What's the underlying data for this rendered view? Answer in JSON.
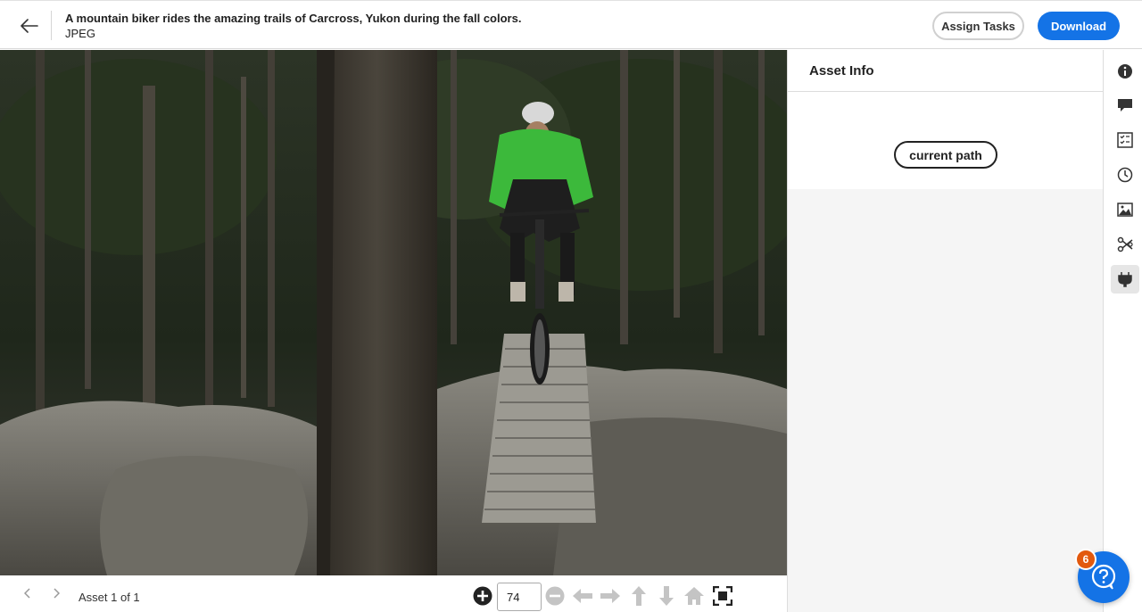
{
  "header": {
    "title": "A mountain biker rides the amazing trails of Carcross, Yukon during the fall colors.",
    "file_type": "JPEG",
    "assign_tasks_label": "Assign Tasks",
    "download_label": "Download",
    "accent_color": "#1473e6"
  },
  "footer": {
    "asset_count": "Asset 1 of 1",
    "zoom_value": "74"
  },
  "panel": {
    "title": "Asset Info",
    "path_button": "current path"
  },
  "rail": {
    "icons": [
      "info-icon",
      "comment-icon",
      "tasks-icon",
      "history-icon",
      "renditions-icon",
      "scissors-icon",
      "plugin-icon"
    ]
  },
  "help": {
    "badge_count": "6"
  }
}
